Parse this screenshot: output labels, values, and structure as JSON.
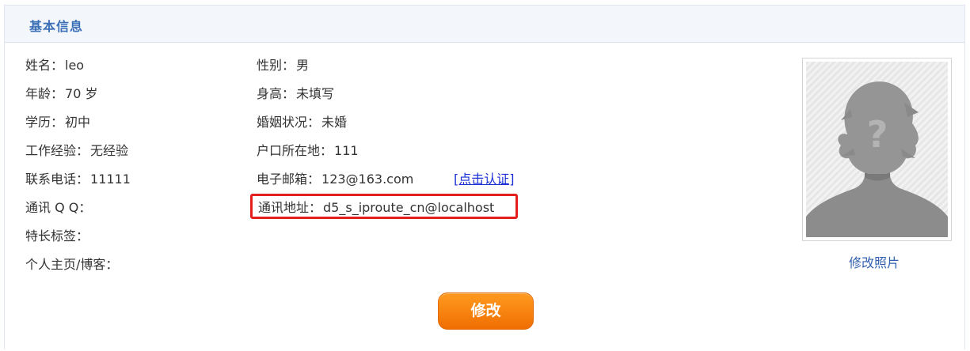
{
  "panel": {
    "title": "基本信息"
  },
  "profile": {
    "name": {
      "label": "姓名：",
      "value": "leo"
    },
    "gender": {
      "label": "性别：",
      "value": "男"
    },
    "age": {
      "label": "年龄：",
      "value": "70 岁"
    },
    "height": {
      "label": "身高：",
      "value": "未填写"
    },
    "education": {
      "label": "学历：",
      "value": "初中"
    },
    "marital": {
      "label": "婚姻状况：",
      "value": "未婚"
    },
    "experience": {
      "label": "工作经验：",
      "value": "无经验"
    },
    "hukou": {
      "label": "户口所在地：",
      "value": "111"
    },
    "phone": {
      "label": "联系电话：",
      "value": "11111"
    },
    "email": {
      "label": "电子邮箱：",
      "value": "123@163.com",
      "verify_link": "[点击认证]"
    },
    "qq": {
      "label": "通讯 Q Q：",
      "value": ""
    },
    "address": {
      "label": "通讯地址：",
      "value": "d5_s_iproute_cn@localhost"
    },
    "tags": {
      "label": "特长标签：",
      "value": ""
    },
    "homepage": {
      "label": "个人主页/博客：",
      "value": ""
    }
  },
  "photo": {
    "icon": "default-avatar-silhouette",
    "change_link": "修改照片"
  },
  "actions": {
    "edit_button": "修改"
  },
  "colors": {
    "title": "#3b6fb6",
    "link": "#1a2fd6",
    "highlight": "#e41d1d",
    "button": "#f27a07"
  }
}
